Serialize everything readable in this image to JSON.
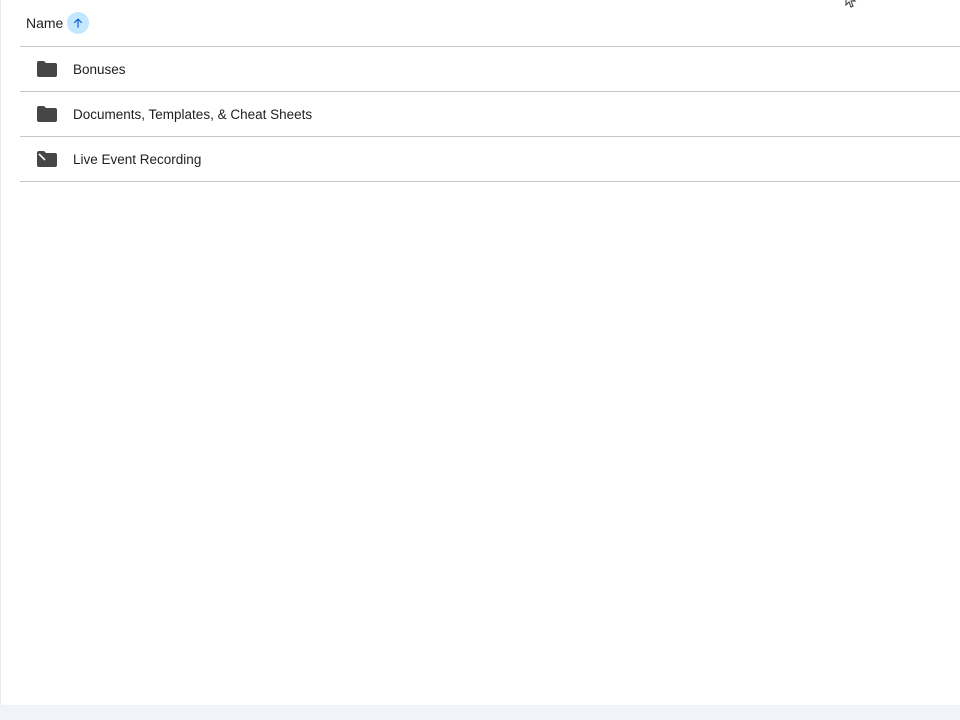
{
  "header": {
    "column_label": "Name",
    "sort_icon": "arrow-up-icon",
    "sort_direction": "ascending"
  },
  "items": [
    {
      "label": "Bonuses",
      "icon": "folder-icon"
    },
    {
      "label": "Documents, Templates, & Cheat Sheets",
      "icon": "folder-icon"
    },
    {
      "label": "Live Event Recording",
      "icon": "shared-folder-icon"
    }
  ],
  "colors": {
    "sort_button_bg": "#c2e7ff",
    "divider": "#c4c7c5",
    "icon": "#444746"
  }
}
